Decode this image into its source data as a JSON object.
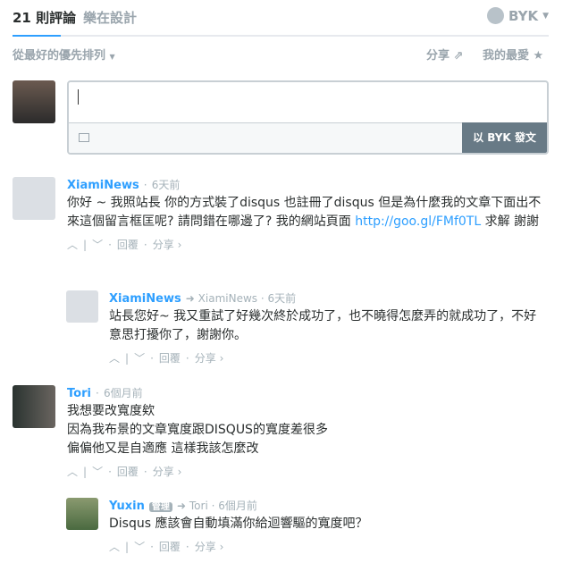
{
  "nav": {
    "tab_comments": "21 則評論",
    "tab_site": "樂在設計",
    "user": "BYK"
  },
  "toolbar": {
    "sort": "從最好的優先排列",
    "share": "分享",
    "favorite": "我的最愛"
  },
  "composer": {
    "placeholder": "",
    "post_button": "以 BYK 發文"
  },
  "actions": {
    "reply": "回覆",
    "share": "分享 ›"
  },
  "comments": [
    {
      "author": "XiamiNews",
      "time": "6天前",
      "text_before": "你好 ~ 我照站長 你的方式裝了disqus 也註冊了disqus 但是為什麼我的文章下面出不來這個留言框匡呢? 請問錯在哪邊了? 我的網站頁面 ",
      "link": "http://goo.gl/FMf0TL",
      "text_after": " 求解 謝謝"
    },
    {
      "author": "XiamiNews",
      "reply_to": "XiamiNews",
      "time": "6天前",
      "text": "站長您好~ 我又重試了好幾次終於成功了，也不曉得怎麼弄的就成功了，不好意思打擾你了，謝謝你。"
    },
    {
      "author": "Tori",
      "time": "6個月前",
      "lines": [
        "我想要改寬度欸",
        "因為我布景的文章寬度跟DISQUS的寬度差很多",
        "偏偏他又是自適應 這樣我該怎麼改"
      ]
    },
    {
      "author": "Yuxin",
      "badge": "管理",
      "reply_to": "Tori",
      "time": "6個月前",
      "text": "Disqus 應該會自動填滿你給迴響驅的寬度吧？"
    }
  ],
  "colors": {
    "accent": "#2e9fff",
    "button": "#687a86"
  }
}
